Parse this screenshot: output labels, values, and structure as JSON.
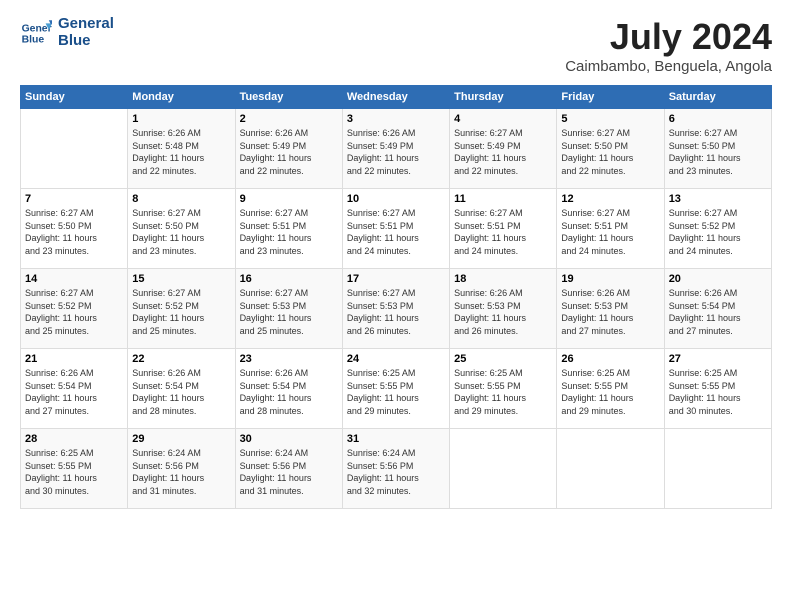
{
  "logo": {
    "line1": "General",
    "line2": "Blue"
  },
  "title": "July 2024",
  "subtitle": "Caimbambo, Benguela, Angola",
  "headers": [
    "Sunday",
    "Monday",
    "Tuesday",
    "Wednesday",
    "Thursday",
    "Friday",
    "Saturday"
  ],
  "weeks": [
    [
      {
        "num": "",
        "info": ""
      },
      {
        "num": "1",
        "info": "Sunrise: 6:26 AM\nSunset: 5:48 PM\nDaylight: 11 hours\nand 22 minutes."
      },
      {
        "num": "2",
        "info": "Sunrise: 6:26 AM\nSunset: 5:49 PM\nDaylight: 11 hours\nand 22 minutes."
      },
      {
        "num": "3",
        "info": "Sunrise: 6:26 AM\nSunset: 5:49 PM\nDaylight: 11 hours\nand 22 minutes."
      },
      {
        "num": "4",
        "info": "Sunrise: 6:27 AM\nSunset: 5:49 PM\nDaylight: 11 hours\nand 22 minutes."
      },
      {
        "num": "5",
        "info": "Sunrise: 6:27 AM\nSunset: 5:50 PM\nDaylight: 11 hours\nand 22 minutes."
      },
      {
        "num": "6",
        "info": "Sunrise: 6:27 AM\nSunset: 5:50 PM\nDaylight: 11 hours\nand 23 minutes."
      }
    ],
    [
      {
        "num": "7",
        "info": "Sunrise: 6:27 AM\nSunset: 5:50 PM\nDaylight: 11 hours\nand 23 minutes."
      },
      {
        "num": "8",
        "info": "Sunrise: 6:27 AM\nSunset: 5:50 PM\nDaylight: 11 hours\nand 23 minutes."
      },
      {
        "num": "9",
        "info": "Sunrise: 6:27 AM\nSunset: 5:51 PM\nDaylight: 11 hours\nand 23 minutes."
      },
      {
        "num": "10",
        "info": "Sunrise: 6:27 AM\nSunset: 5:51 PM\nDaylight: 11 hours\nand 24 minutes."
      },
      {
        "num": "11",
        "info": "Sunrise: 6:27 AM\nSunset: 5:51 PM\nDaylight: 11 hours\nand 24 minutes."
      },
      {
        "num": "12",
        "info": "Sunrise: 6:27 AM\nSunset: 5:51 PM\nDaylight: 11 hours\nand 24 minutes."
      },
      {
        "num": "13",
        "info": "Sunrise: 6:27 AM\nSunset: 5:52 PM\nDaylight: 11 hours\nand 24 minutes."
      }
    ],
    [
      {
        "num": "14",
        "info": "Sunrise: 6:27 AM\nSunset: 5:52 PM\nDaylight: 11 hours\nand 25 minutes."
      },
      {
        "num": "15",
        "info": "Sunrise: 6:27 AM\nSunset: 5:52 PM\nDaylight: 11 hours\nand 25 minutes."
      },
      {
        "num": "16",
        "info": "Sunrise: 6:27 AM\nSunset: 5:53 PM\nDaylight: 11 hours\nand 25 minutes."
      },
      {
        "num": "17",
        "info": "Sunrise: 6:27 AM\nSunset: 5:53 PM\nDaylight: 11 hours\nand 26 minutes."
      },
      {
        "num": "18",
        "info": "Sunrise: 6:26 AM\nSunset: 5:53 PM\nDaylight: 11 hours\nand 26 minutes."
      },
      {
        "num": "19",
        "info": "Sunrise: 6:26 AM\nSunset: 5:53 PM\nDaylight: 11 hours\nand 27 minutes."
      },
      {
        "num": "20",
        "info": "Sunrise: 6:26 AM\nSunset: 5:54 PM\nDaylight: 11 hours\nand 27 minutes."
      }
    ],
    [
      {
        "num": "21",
        "info": "Sunrise: 6:26 AM\nSunset: 5:54 PM\nDaylight: 11 hours\nand 27 minutes."
      },
      {
        "num": "22",
        "info": "Sunrise: 6:26 AM\nSunset: 5:54 PM\nDaylight: 11 hours\nand 28 minutes."
      },
      {
        "num": "23",
        "info": "Sunrise: 6:26 AM\nSunset: 5:54 PM\nDaylight: 11 hours\nand 28 minutes."
      },
      {
        "num": "24",
        "info": "Sunrise: 6:25 AM\nSunset: 5:55 PM\nDaylight: 11 hours\nand 29 minutes."
      },
      {
        "num": "25",
        "info": "Sunrise: 6:25 AM\nSunset: 5:55 PM\nDaylight: 11 hours\nand 29 minutes."
      },
      {
        "num": "26",
        "info": "Sunrise: 6:25 AM\nSunset: 5:55 PM\nDaylight: 11 hours\nand 29 minutes."
      },
      {
        "num": "27",
        "info": "Sunrise: 6:25 AM\nSunset: 5:55 PM\nDaylight: 11 hours\nand 30 minutes."
      }
    ],
    [
      {
        "num": "28",
        "info": "Sunrise: 6:25 AM\nSunset: 5:55 PM\nDaylight: 11 hours\nand 30 minutes."
      },
      {
        "num": "29",
        "info": "Sunrise: 6:24 AM\nSunset: 5:56 PM\nDaylight: 11 hours\nand 31 minutes."
      },
      {
        "num": "30",
        "info": "Sunrise: 6:24 AM\nSunset: 5:56 PM\nDaylight: 11 hours\nand 31 minutes."
      },
      {
        "num": "31",
        "info": "Sunrise: 6:24 AM\nSunset: 5:56 PM\nDaylight: 11 hours\nand 32 minutes."
      },
      {
        "num": "",
        "info": ""
      },
      {
        "num": "",
        "info": ""
      },
      {
        "num": "",
        "info": ""
      }
    ]
  ]
}
